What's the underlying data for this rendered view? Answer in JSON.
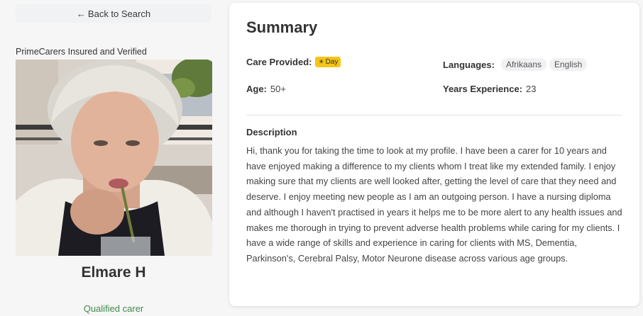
{
  "left": {
    "back_label": "Back to Search",
    "verified_text": "PrimeCarers Insured and Verified",
    "name": "Elmare H",
    "qualified": "Qualified carer"
  },
  "summary": {
    "title": "Summary",
    "care_label": "Care Provided:",
    "care_badge": "Day",
    "age_label": "Age:",
    "age_value": "50+",
    "languages_label": "Languages:",
    "languages": [
      "Afrikaans",
      "English"
    ],
    "experience_label": "Years Experience:",
    "experience_value": "23",
    "description_title": "Description",
    "description": "Hi, thank you for taking the time to look at my profile. I have been a carer for 10 years and have enjoyed making a difference to my clients whom I treat like my extended family. I enjoy making sure that my clients are well looked after, getting the level of care that they need and deserve. I enjoy meeting new people as I am an outgoing person. I have a nursing diploma and although I haven't practised in years it helps me to be more alert to any health issues and makes me thorough in trying to prevent adverse health problems while caring for my clients. I have a wide range of skills and experience in caring for clients with MS, Dementia, Parkinson's, Cerebral Palsy, Motor Neurone disease across various age groups."
  },
  "colors": {
    "badge": "#f5c518",
    "qualified": "#3f8a4a"
  }
}
